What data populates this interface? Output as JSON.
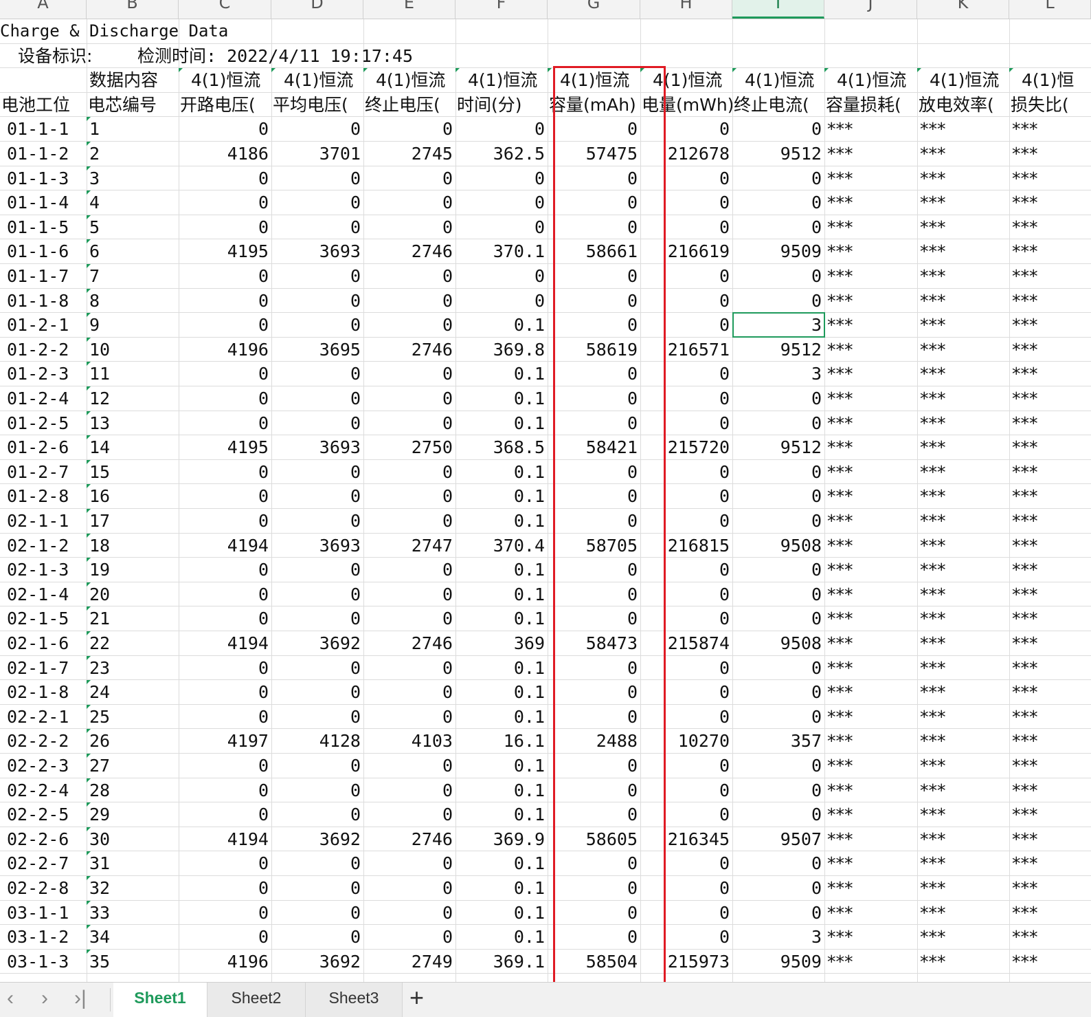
{
  "columns": [
    "A",
    "B",
    "C",
    "D",
    "E",
    "F",
    "G",
    "H",
    "I",
    "J",
    "K",
    "L"
  ],
  "selected_column": "I",
  "title": "Charge & Discharge Data",
  "device_line": {
    "label": "设备标识:",
    "time_label": "检测时间:",
    "time_value": "2022/4/11 19:17:45"
  },
  "header1": [
    "",
    "数据内容",
    "4(1)恒流",
    "4(1)恒流",
    "4(1)恒流",
    "4(1)恒流",
    "4(1)恒流",
    "4(1)恒流",
    "4(1)恒流",
    "4(1)恒流",
    "4(1)恒流",
    "4(1)恒"
  ],
  "header2": [
    "电池工位",
    "电芯编号",
    "开路电压(",
    "平均电压(",
    "终止电压(",
    "时间(分)",
    "容量(mAh)",
    "电量(mWh)",
    "终止电流(",
    "容量损耗(",
    "放电效率(",
    "损失比("
  ],
  "rows": [
    [
      "01-1-1",
      "1",
      "0",
      "0",
      "0",
      "0",
      "0",
      "0",
      "0",
      "***",
      "***",
      "***"
    ],
    [
      "01-1-2",
      "2",
      "4186",
      "3701",
      "2745",
      "362.5",
      "57475",
      "212678",
      "9512",
      "***",
      "***",
      "***"
    ],
    [
      "01-1-3",
      "3",
      "0",
      "0",
      "0",
      "0",
      "0",
      "0",
      "0",
      "***",
      "***",
      "***"
    ],
    [
      "01-1-4",
      "4",
      "0",
      "0",
      "0",
      "0",
      "0",
      "0",
      "0",
      "***",
      "***",
      "***"
    ],
    [
      "01-1-5",
      "5",
      "0",
      "0",
      "0",
      "0",
      "0",
      "0",
      "0",
      "***",
      "***",
      "***"
    ],
    [
      "01-1-6",
      "6",
      "4195",
      "3693",
      "2746",
      "370.1",
      "58661",
      "216619",
      "9509",
      "***",
      "***",
      "***"
    ],
    [
      "01-1-7",
      "7",
      "0",
      "0",
      "0",
      "0",
      "0",
      "0",
      "0",
      "***",
      "***",
      "***"
    ],
    [
      "01-1-8",
      "8",
      "0",
      "0",
      "0",
      "0",
      "0",
      "0",
      "0",
      "***",
      "***",
      "***"
    ],
    [
      "01-2-1",
      "9",
      "0",
      "0",
      "0",
      "0.1",
      "0",
      "0",
      "3",
      "***",
      "***",
      "***"
    ],
    [
      "01-2-2",
      "10",
      "4196",
      "3695",
      "2746",
      "369.8",
      "58619",
      "216571",
      "9512",
      "***",
      "***",
      "***"
    ],
    [
      "01-2-3",
      "11",
      "0",
      "0",
      "0",
      "0.1",
      "0",
      "0",
      "3",
      "***",
      "***",
      "***"
    ],
    [
      "01-2-4",
      "12",
      "0",
      "0",
      "0",
      "0.1",
      "0",
      "0",
      "0",
      "***",
      "***",
      "***"
    ],
    [
      "01-2-5",
      "13",
      "0",
      "0",
      "0",
      "0.1",
      "0",
      "0",
      "0",
      "***",
      "***",
      "***"
    ],
    [
      "01-2-6",
      "14",
      "4195",
      "3693",
      "2750",
      "368.5",
      "58421",
      "215720",
      "9512",
      "***",
      "***",
      "***"
    ],
    [
      "01-2-7",
      "15",
      "0",
      "0",
      "0",
      "0.1",
      "0",
      "0",
      "0",
      "***",
      "***",
      "***"
    ],
    [
      "01-2-8",
      "16",
      "0",
      "0",
      "0",
      "0.1",
      "0",
      "0",
      "0",
      "***",
      "***",
      "***"
    ],
    [
      "02-1-1",
      "17",
      "0",
      "0",
      "0",
      "0.1",
      "0",
      "0",
      "0",
      "***",
      "***",
      "***"
    ],
    [
      "02-1-2",
      "18",
      "4194",
      "3693",
      "2747",
      "370.4",
      "58705",
      "216815",
      "9508",
      "***",
      "***",
      "***"
    ],
    [
      "02-1-3",
      "19",
      "0",
      "0",
      "0",
      "0.1",
      "0",
      "0",
      "0",
      "***",
      "***",
      "***"
    ],
    [
      "02-1-4",
      "20",
      "0",
      "0",
      "0",
      "0.1",
      "0",
      "0",
      "0",
      "***",
      "***",
      "***"
    ],
    [
      "02-1-5",
      "21",
      "0",
      "0",
      "0",
      "0.1",
      "0",
      "0",
      "0",
      "***",
      "***",
      "***"
    ],
    [
      "02-1-6",
      "22",
      "4194",
      "3692",
      "2746",
      "369",
      "58473",
      "215874",
      "9508",
      "***",
      "***",
      "***"
    ],
    [
      "02-1-7",
      "23",
      "0",
      "0",
      "0",
      "0.1",
      "0",
      "0",
      "0",
      "***",
      "***",
      "***"
    ],
    [
      "02-1-8",
      "24",
      "0",
      "0",
      "0",
      "0.1",
      "0",
      "0",
      "0",
      "***",
      "***",
      "***"
    ],
    [
      "02-2-1",
      "25",
      "0",
      "0",
      "0",
      "0.1",
      "0",
      "0",
      "0",
      "***",
      "***",
      "***"
    ],
    [
      "02-2-2",
      "26",
      "4197",
      "4128",
      "4103",
      "16.1",
      "2488",
      "10270",
      "357",
      "***",
      "***",
      "***"
    ],
    [
      "02-2-3",
      "27",
      "0",
      "0",
      "0",
      "0.1",
      "0",
      "0",
      "0",
      "***",
      "***",
      "***"
    ],
    [
      "02-2-4",
      "28",
      "0",
      "0",
      "0",
      "0.1",
      "0",
      "0",
      "0",
      "***",
      "***",
      "***"
    ],
    [
      "02-2-5",
      "29",
      "0",
      "0",
      "0",
      "0.1",
      "0",
      "0",
      "0",
      "***",
      "***",
      "***"
    ],
    [
      "02-2-6",
      "30",
      "4194",
      "3692",
      "2746",
      "369.9",
      "58605",
      "216345",
      "9507",
      "***",
      "***",
      "***"
    ],
    [
      "02-2-7",
      "31",
      "0",
      "0",
      "0",
      "0.1",
      "0",
      "0",
      "0",
      "***",
      "***",
      "***"
    ],
    [
      "02-2-8",
      "32",
      "0",
      "0",
      "0",
      "0.1",
      "0",
      "0",
      "0",
      "***",
      "***",
      "***"
    ],
    [
      "03-1-1",
      "33",
      "0",
      "0",
      "0",
      "0.1",
      "0",
      "0",
      "0",
      "***",
      "***",
      "***"
    ],
    [
      "03-1-2",
      "34",
      "0",
      "0",
      "0",
      "0.1",
      "0",
      "0",
      "3",
      "***",
      "***",
      "***"
    ],
    [
      "03-1-3",
      "35",
      "4196",
      "3692",
      "2749",
      "369.1",
      "58504",
      "215973",
      "9509",
      "***",
      "***",
      "***"
    ]
  ],
  "tabs": [
    "Sheet1",
    "Sheet2",
    "Sheet3"
  ],
  "active_tab": "Sheet1",
  "nav": {
    "prev": "‹",
    "next": "›",
    "last": "›|",
    "add": "+"
  },
  "accent_color": "#1e9a5b",
  "highlight_color": "#e01b24"
}
